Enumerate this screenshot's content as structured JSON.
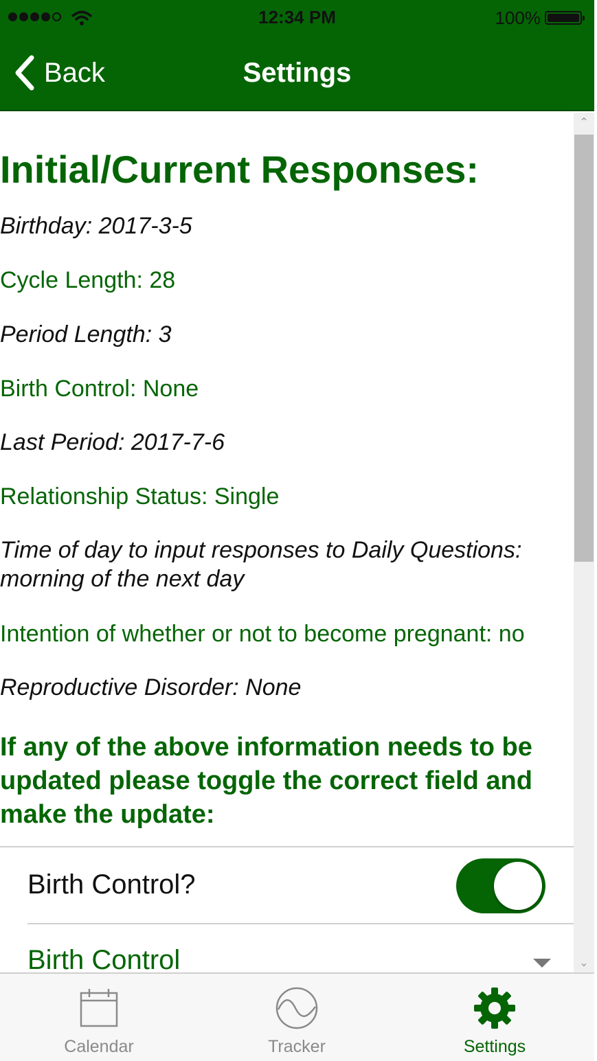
{
  "status_bar": {
    "time": "12:34 PM",
    "battery": "100%"
  },
  "nav": {
    "back_label": "Back",
    "title": "Settings"
  },
  "content": {
    "heading": "Initial/Current Responses:",
    "responses": [
      {
        "text": "Birthday: 2017-3-5"
      },
      {
        "text": "Cycle Length: 28"
      },
      {
        "text": "Period Length: 3"
      },
      {
        "text": "Birth Control: None"
      },
      {
        "text": "Last Period: 2017-7-6"
      },
      {
        "text": "Relationship Status: Single"
      },
      {
        "text": "Time of day to input responses to Daily Questions: morning of the next day"
      },
      {
        "text": "Intention of whether or not to become pregnant: no"
      },
      {
        "text": "Reproductive Disorder: None"
      }
    ],
    "instructions": "If any of the above information needs to be updated please toggle the correct field and make the update:",
    "toggle_row": {
      "label": "Birth Control?",
      "value": true
    },
    "dropdown_row": {
      "label": "Birth Control"
    }
  },
  "tabs": [
    {
      "label": "Calendar",
      "icon": "calendar-icon",
      "active": false
    },
    {
      "label": "Tracker",
      "icon": "wave-icon",
      "active": false
    },
    {
      "label": "Settings",
      "icon": "gear-icon",
      "active": true
    }
  ],
  "colors": {
    "primary": "#056505",
    "inactive_tab": "#8a8a8a"
  }
}
